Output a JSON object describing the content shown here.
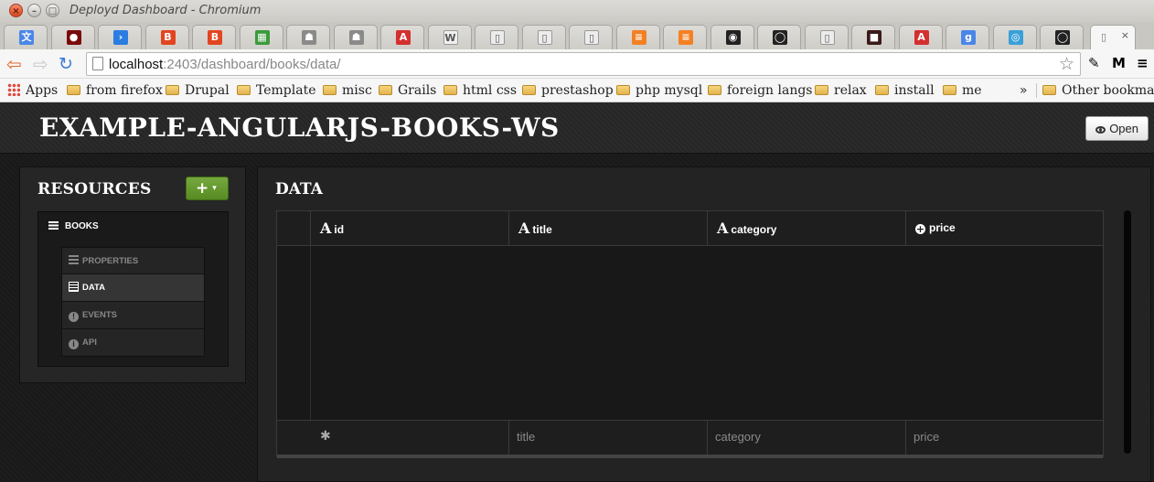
{
  "window": {
    "title": "Deployd Dashboard - Chromium",
    "close_glyph": "×",
    "min_glyph": "–",
    "max_glyph": "□"
  },
  "tabs": [
    {
      "icon": "translate-icon",
      "glyph": "文",
      "color": "#4a86e8"
    },
    {
      "icon": "red-orb-icon",
      "glyph": "●",
      "color": "#7a0a0a"
    },
    {
      "icon": "blue-arrow-icon",
      "glyph": "›",
      "color": "#2a7de1"
    },
    {
      "icon": "bootstrap-icon",
      "glyph": "B",
      "color": "#e2451f"
    },
    {
      "icon": "bootstrap-icon",
      "glyph": "B",
      "color": "#e2451f"
    },
    {
      "icon": "windows-icon",
      "glyph": "▦",
      "color": "#3c9a3c"
    },
    {
      "icon": "robot-icon",
      "glyph": "☗",
      "color": "#8a8a8a"
    },
    {
      "icon": "robot-icon",
      "glyph": "☗",
      "color": "#8a8a8a"
    },
    {
      "icon": "angular-icon",
      "glyph": "A",
      "color": "#d3302f"
    },
    {
      "icon": "wikipedia-icon",
      "glyph": "W",
      "color": "#f0f0f0"
    },
    {
      "icon": "page-icon",
      "glyph": "▯",
      "color": "#ececec"
    },
    {
      "icon": "page-icon",
      "glyph": "▯",
      "color": "#ececec"
    },
    {
      "icon": "page-icon",
      "glyph": "▯",
      "color": "#ececec"
    },
    {
      "icon": "stackoverflow-icon",
      "glyph": "≡",
      "color": "#f48024"
    },
    {
      "icon": "stackoverflow-icon",
      "glyph": "≡",
      "color": "#f48024"
    },
    {
      "icon": "deployd-icon",
      "glyph": "◉",
      "color": "#222222"
    },
    {
      "icon": "github-icon",
      "glyph": "◯",
      "color": "#222222"
    },
    {
      "icon": "page-icon",
      "glyph": "▯",
      "color": "#ececec"
    },
    {
      "icon": "dark-app-icon",
      "glyph": "■",
      "color": "#3a1a1a"
    },
    {
      "icon": "angular-icon",
      "glyph": "A",
      "color": "#d3302f"
    },
    {
      "icon": "google-icon",
      "glyph": "g",
      "color": "#4a86e8"
    },
    {
      "icon": "swirl-icon",
      "glyph": "◎",
      "color": "#3aa0d8"
    },
    {
      "icon": "github-icon",
      "glyph": "◯",
      "color": "#222222"
    }
  ],
  "active_tab": {
    "glyph": "▯",
    "close_glyph": "×"
  },
  "toolbar": {
    "back_glyph": "⇦",
    "forward_glyph": "⇨",
    "reload_glyph": "↻",
    "url_host": "localhost",
    "url_path": ":2403/dashboard/books/data/",
    "star_glyph": "☆",
    "ext_icons": [
      {
        "icon": "eyedropper-icon",
        "glyph": "✎",
        "color": "#3d6fb0"
      },
      {
        "icon": "gmail-icon",
        "glyph": "M",
        "color": "#4a6fb8"
      },
      {
        "icon": "menu-icon",
        "glyph": "≡",
        "color": "#666666"
      }
    ]
  },
  "bookmarks": {
    "items": [
      "Apps",
      "from firefox",
      "Drupal",
      "Template",
      "misc",
      "Grails",
      "html css",
      "prestashop",
      "php mysql",
      "foreign langs",
      "relax",
      "install",
      "me"
    ],
    "more": "»",
    "other": "Other bookmarks"
  },
  "dashboard": {
    "app_title": "EXAMPLE-ANGULARJS-BOOKS-WS",
    "open_button": "Open",
    "sidebar": {
      "title": "RESOURCES",
      "add_glyph": "+",
      "caret_glyph": "▾",
      "resource": "BOOKS",
      "nav": [
        {
          "label": "PROPERTIES",
          "icon": "list-icon"
        },
        {
          "label": "DATA",
          "icon": "table-icon",
          "active": true
        },
        {
          "label": "EVENTS",
          "icon": "exclamation-icon"
        },
        {
          "label": "API",
          "icon": "info-icon"
        }
      ]
    },
    "main": {
      "title": "DATA",
      "columns": [
        {
          "name": "id",
          "type_glyph": "A"
        },
        {
          "name": "title",
          "type_glyph": "A"
        },
        {
          "name": "category",
          "type_glyph": "A"
        },
        {
          "name": "price",
          "type_glyph": "+"
        }
      ],
      "rows": [],
      "new_row": {
        "id_glyph": "✱",
        "title_placeholder": "title",
        "category_placeholder": "category",
        "price_placeholder": "price"
      }
    }
  }
}
